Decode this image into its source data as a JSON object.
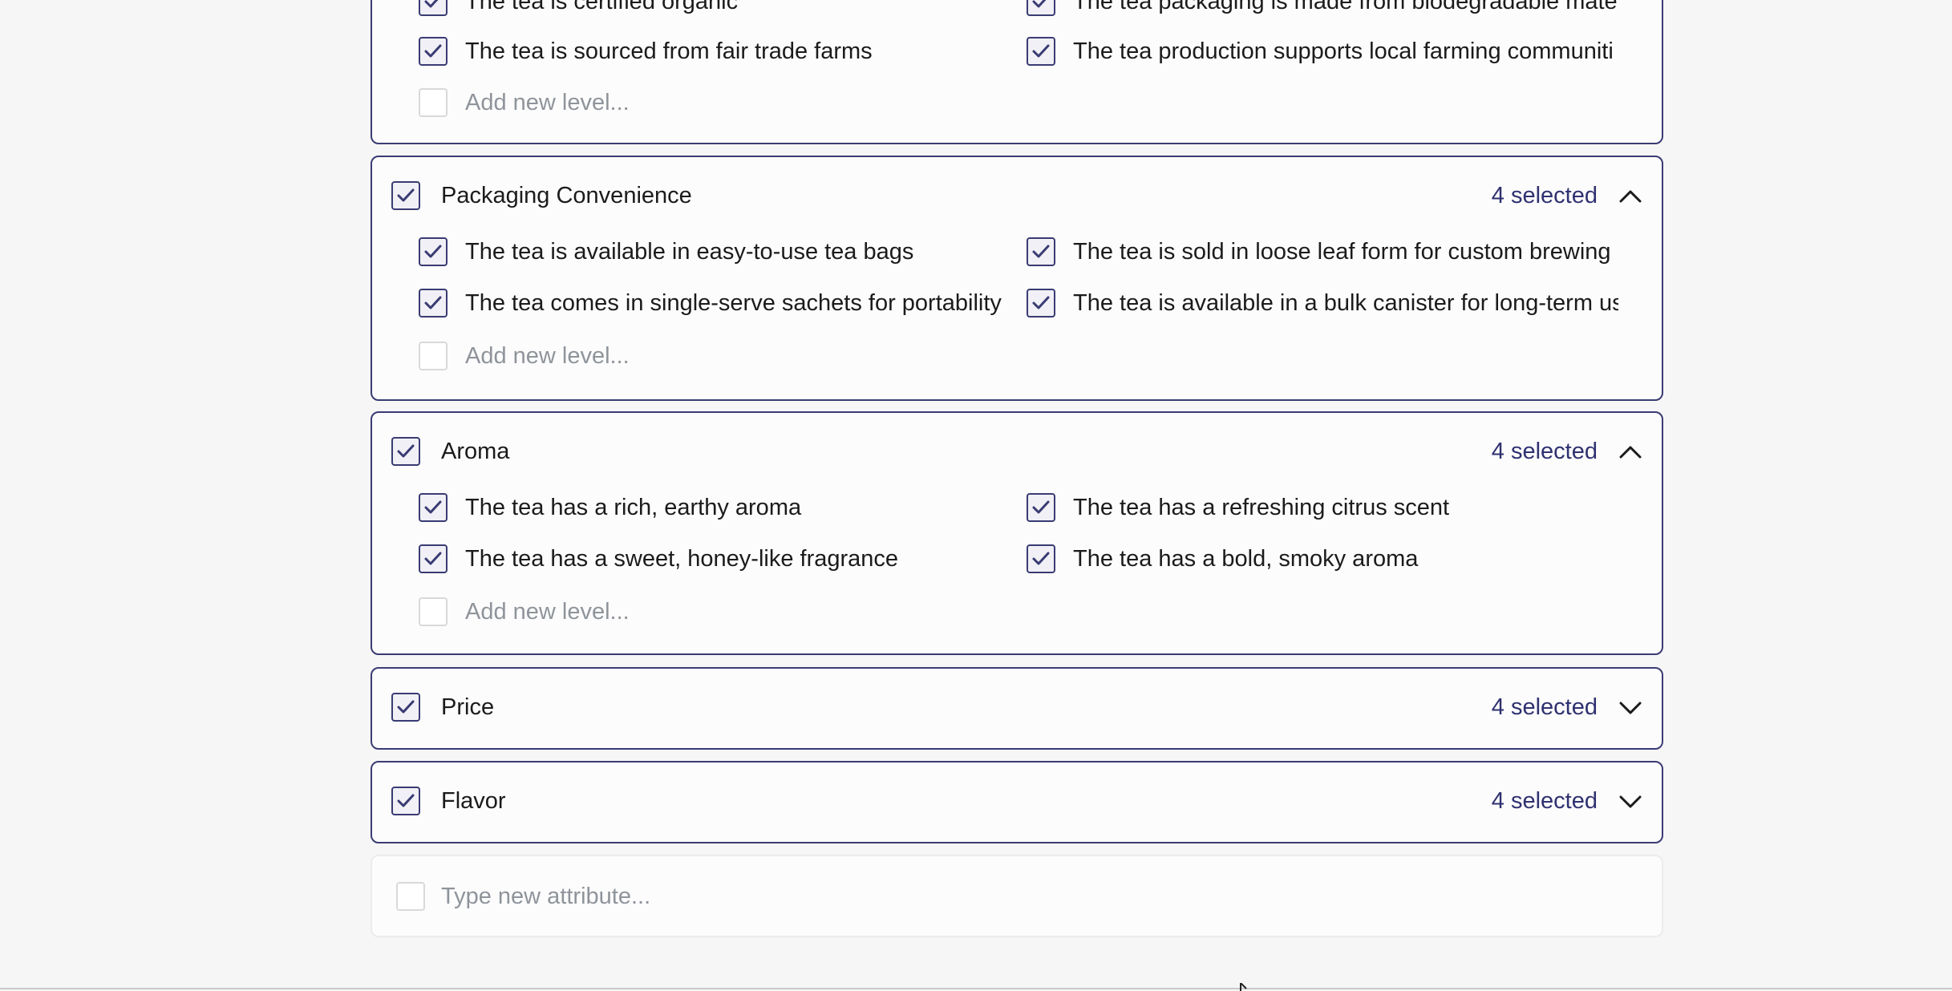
{
  "groups": [
    {
      "title": "",
      "levels": [
        "The tea is certified organic",
        "The tea packaging is made from biodegradable mater",
        "The tea is sourced from fair trade farms",
        "The tea production supports local farming communiti"
      ],
      "add_placeholder": "Add new level..."
    },
    {
      "title": "Packaging Convenience",
      "count_label": "4 selected",
      "expanded": true,
      "levels": [
        "The tea is available in easy-to-use tea bags",
        "The tea is sold in loose leaf form for custom brewing",
        "The tea comes in single-serve sachets for portability",
        "The tea is available in a bulk canister for long-term us"
      ],
      "add_placeholder": "Add new level..."
    },
    {
      "title": "Aroma",
      "count_label": "4 selected",
      "expanded": true,
      "levels": [
        "The tea has a rich, earthy aroma",
        "The tea has a refreshing citrus scent",
        "The tea has a sweet, honey-like fragrance",
        "The tea has a bold, smoky aroma"
      ],
      "add_placeholder": "Add new level..."
    },
    {
      "title": "Price",
      "count_label": "4 selected",
      "expanded": false
    },
    {
      "title": "Flavor",
      "count_label": "4 selected",
      "expanded": false
    }
  ],
  "new_attribute_placeholder": "Type new attribute...",
  "colors": {
    "accent": "#3a3b73",
    "count_text": "#2f3170",
    "placeholder": "#8f949b",
    "background": "#f6f6f6"
  },
  "icons": {
    "check": "check-icon",
    "collapse": "chevron-up-icon",
    "expand": "chevron-down-icon"
  }
}
